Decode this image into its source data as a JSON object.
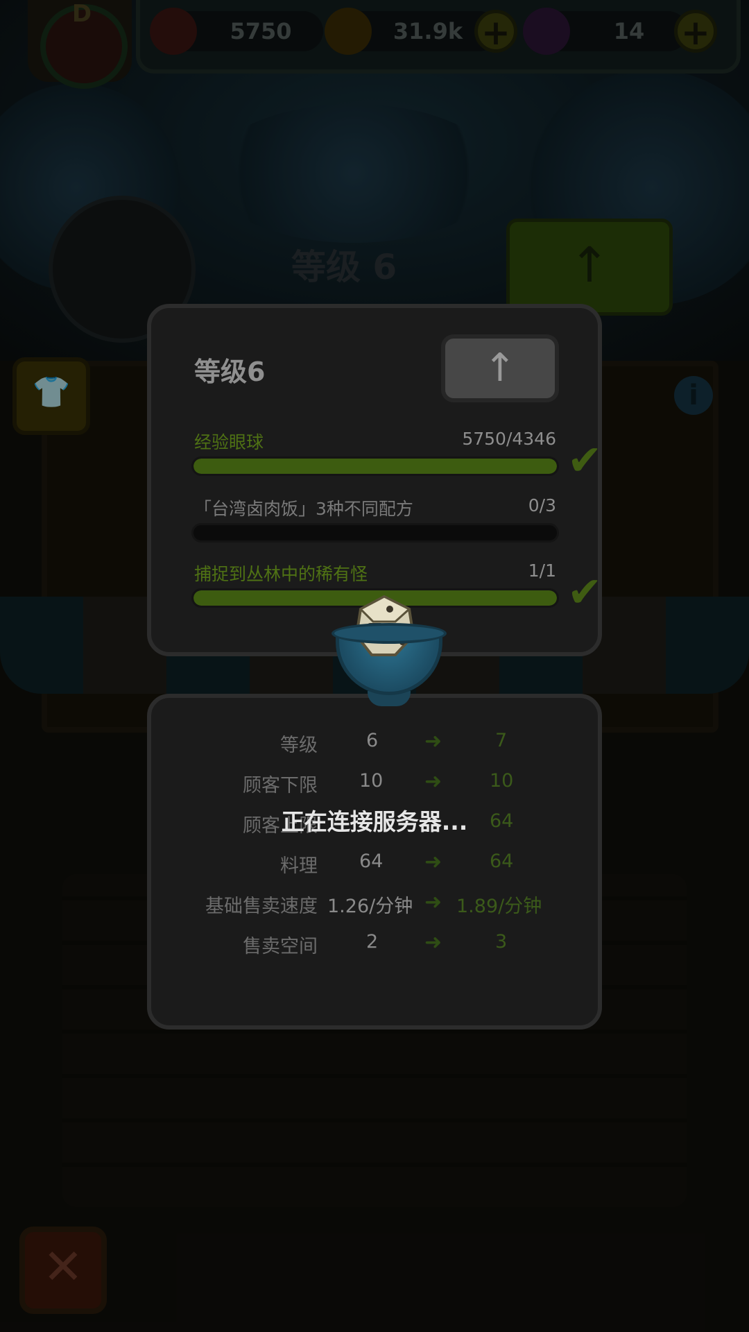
{
  "hud": {
    "eyeballs": "5750",
    "coins": "31.9k",
    "potions": "14",
    "avatar_badge": "D",
    "plus_label": "+"
  },
  "background": {
    "level_text": "等级 6",
    "info_label": "i"
  },
  "panel": {
    "title": "等级6",
    "upgrade_icon": "↑",
    "requirements": [
      {
        "label": "经验眼球",
        "value": "5750/4346",
        "progress": 1.0,
        "complete": true
      },
      {
        "label": "「台湾卤肉饭」3种不同配方",
        "value": "0/3",
        "progress": 0.0,
        "complete": false
      },
      {
        "label": "捕捉到丛林中的稀有怪",
        "value": "1/1",
        "progress": 1.0,
        "complete": true
      }
    ]
  },
  "stats": {
    "rows": [
      {
        "label": "等级",
        "current": "6",
        "next": "7"
      },
      {
        "label": "顾客下限",
        "current": "10",
        "next": "10"
      },
      {
        "label": "顾客上限",
        "current": "",
        "next": "64"
      },
      {
        "label": "料理",
        "current": "64",
        "next": "64"
      },
      {
        "label": "基础售卖速度",
        "current": "1.26/分钟",
        "next": "1.89/分钟"
      },
      {
        "label": "售卖空间",
        "current": "2",
        "next": "3"
      }
    ]
  },
  "loading": {
    "text": "正在连接服务器..."
  },
  "icons": {
    "check": "check-icon",
    "arrow": "arrow-right-icon",
    "close": "close-icon"
  },
  "colors": {
    "accent_green": "#3d5c10",
    "panel_bg": "#1b1b1b"
  }
}
